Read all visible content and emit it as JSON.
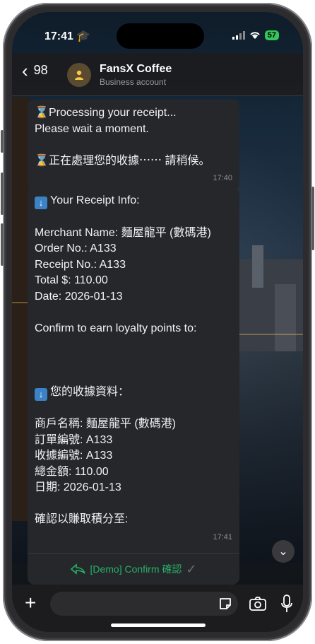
{
  "status": {
    "time": "17:41",
    "battery": "57"
  },
  "header": {
    "back_count": "98",
    "name": "FansX Coffee",
    "subtitle": "Business account"
  },
  "messages": [
    {
      "lines": [
        "Processing your receipt...",
        "Please wait a moment.",
        "",
        "正在處理您的收據⋯⋯ 請稍候。"
      ],
      "time": "17:40"
    },
    {
      "lines": [
        "Your Receipt Info:",
        "",
        "Merchant Name: 麵屋龍平 (數碼港)",
        "Order No.: A133",
        "Receipt No.: A133",
        "Total $: 110.00",
        "Date: 2026-01-13",
        "",
        "Confirm to earn loyalty points to:",
        "",
        "",
        "",
        "您的收據資料：",
        "",
        "商戶名稱: 麵屋龍平 (數碼港)",
        "訂單編號: A133",
        "收據編號: A133",
        "總金額: 110.00",
        "日期: 2026-01-13",
        "",
        "確認以賺取積分至:"
      ],
      "time": "17:41",
      "action_label": "[Demo] Confirm 確認"
    }
  ],
  "colors": {
    "accent": "#25b26a",
    "bubble": "#26272a",
    "battery": "#34c759"
  },
  "icons": [
    "graduation-cap-icon",
    "signal-icon",
    "wifi-icon",
    "battery-icon",
    "hourglass-icon",
    "down-arrow-emoji-icon",
    "reply-icon",
    "check-icon",
    "chevron-down-icon",
    "plus-icon",
    "sticker-icon",
    "camera-icon",
    "mic-icon"
  ]
}
